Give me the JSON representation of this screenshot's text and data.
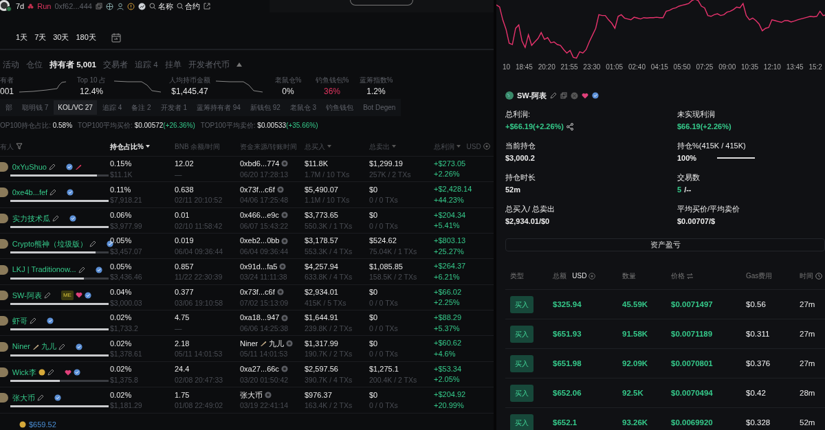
{
  "header": {
    "period": "7d",
    "run_label": "Run",
    "address": "0xf62...444",
    "search_links": [
      "名称",
      "合约"
    ]
  },
  "ranges": [
    {
      "label": "1天",
      "selected": false
    },
    {
      "label": "7天",
      "selected": false
    },
    {
      "label": "30天",
      "selected": false
    },
    {
      "label": "180天",
      "selected": false
    }
  ],
  "tabs": [
    {
      "label": "活动",
      "selected": false
    },
    {
      "label": "仓位",
      "selected": false
    },
    {
      "label": "持有者 5,001",
      "selected": true
    },
    {
      "label": "交易者",
      "selected": false
    },
    {
      "label": "追踪 4",
      "selected": false
    },
    {
      "label": "挂单",
      "selected": false
    },
    {
      "label": "开发者代币",
      "selected": false
    }
  ],
  "stats": [
    {
      "label": "有者",
      "value": "001",
      "alert": false,
      "kind": "rising"
    },
    {
      "label": "Top 10 占",
      "value": "12.4%",
      "alert": false,
      "kind": "falling"
    },
    {
      "label": "人均持币金额",
      "value": "$1,445.47",
      "alert": false,
      "kind": "falling"
    },
    {
      "label": "老鼠仓%",
      "value": "0%",
      "alert": false,
      "kind": "plain"
    },
    {
      "label": "钓鱼钱包%",
      "value": "36%",
      "alert": true,
      "kind": "plain"
    },
    {
      "label": "蓝筹指数%",
      "value": "1.2%",
      "alert": false,
      "kind": "plain"
    }
  ],
  "filters": [
    {
      "label": "部",
      "selected": false
    },
    {
      "label": "聪明钱 7",
      "selected": false
    },
    {
      "label": "KOL/VC 27",
      "selected": true
    },
    {
      "label": "追踪 4",
      "selected": false
    },
    {
      "label": "备注 2",
      "selected": false
    },
    {
      "label": "开发者 1",
      "selected": false
    },
    {
      "label": "蓝筹持有者 94",
      "selected": false
    },
    {
      "label": "新钱包 92",
      "selected": false
    },
    {
      "label": "老鼠仓 3",
      "selected": false
    },
    {
      "label": "钓鱼钱包",
      "selected": false
    },
    {
      "label": "Bot Degen",
      "selected": false
    }
  ],
  "summary": [
    {
      "label": "OP100持仓占比:",
      "value": "0.58%"
    },
    {
      "label": "TOP100平均买价:",
      "value": "$0.00572",
      "change": "(+26.36%)"
    },
    {
      "label": "TOP100平均卖价:",
      "value": "$0.00533",
      "change": "(+35.66%)"
    }
  ],
  "holders": {
    "columns": [
      {
        "label": "有人",
        "filter": true,
        "active": false
      },
      {
        "label": "持仓占比%",
        "sort": true,
        "active": true
      },
      {
        "label": "BNB 余额/时间",
        "active": false
      },
      {
        "label": "资金来源/转账时间",
        "active": false
      },
      {
        "label": "总买入",
        "sort": true,
        "active": false
      },
      {
        "label": "总卖出",
        "sort": true,
        "active": false
      },
      {
        "label": "总利润",
        "sort": true,
        "active": false,
        "unit": "USD"
      }
    ],
    "rows": [
      {
        "name": "0xYuShuo",
        "verified": true,
        "pen_mark": true,
        "level": 0.88,
        "pct": "0.15%",
        "value": "$11.1K",
        "bnb": "12.02",
        "bnb_time": "—",
        "source": "0xbd6...774",
        "source_time": "06/20 17:28:13",
        "buy": "$11.8K",
        "buy_sub": "1.7M / 10 TXs",
        "sell": "$1,299.19",
        "sell_sub": "257K / 2 TXs",
        "profit": "+$273.05",
        "profit_pct": "+2.26%"
      },
      {
        "name": "0xe4b...fef",
        "verified": true,
        "level": 1,
        "pct": "0.11%",
        "value": "$7,918.21",
        "bnb": "0.638",
        "bnb_time": "02/11 20:10:52",
        "source": "0x73f...c6f",
        "source_time": "04/06 17:25:48",
        "buy": "$5,490.07",
        "buy_sub": "1.1M / 10 TXs",
        "sell": "$0",
        "sell_sub": "0 / 0 TXs",
        "profit": "+$2,428.14",
        "profit_pct": "+44.23%"
      },
      {
        "name": "实力技术瓜",
        "verified": true,
        "level": 1,
        "pct": "0.06%",
        "value": "$3,977.99",
        "bnb": "0.01",
        "bnb_time": "02/10 11:58:42",
        "source": "0x466...e9c",
        "source_time": "06/07 15:43:22",
        "buy": "$3,773.65",
        "buy_sub": "550.3K / 1 TXs",
        "sell": "$0",
        "sell_sub": "0 / 0 TXs",
        "profit": "+$204.34",
        "profit_pct": "+5.41%"
      },
      {
        "name": "Crypto熊神（垃圾版）",
        "verified": true,
        "level": 0.87,
        "pct": "0.05%",
        "value": "$3,457.07",
        "bnb": "0.019",
        "bnb_time": "06/04 09:36:44",
        "source": "0xeb2...0bb",
        "source_time": "06/04 09:36:44",
        "buy": "$3,178.57",
        "buy_sub": "553.3K / 4 TXs",
        "sell": "$524.62",
        "sell_sub": "75.04K / 1 TXs",
        "profit": "+$803.13",
        "profit_pct": "+25.27%"
      },
      {
        "name": "LKJ | Traditionow...",
        "verified": true,
        "level": 0.75,
        "pct": "0.05%",
        "value": "$3,436.46",
        "bnb": "0.857",
        "bnb_time": "11/22 22:30:39",
        "source": "0x91d...fa5",
        "source_time": "03/24 11:11:38",
        "buy": "$4,257.94",
        "buy_sub": "633.8K / 4 TXs",
        "sell": "$1,085.85",
        "sell_sub": "158.5K / 2 TXs",
        "profit": "+$264.37",
        "profit_pct": "+6.21%"
      },
      {
        "name": "SW-阿表",
        "tag": "ME",
        "verified": true,
        "heart": true,
        "level": 1,
        "pct": "0.04%",
        "value": "$3,000.03",
        "bnb": "0.377",
        "bnb_time": "03/06 19:10:58",
        "source": "0x73f...c6f",
        "source_time": "07/02 15:13:09",
        "buy": "$2,934.01",
        "buy_sub": "415K / 5 TXs",
        "sell": "$0",
        "sell_sub": "0 / 0 TXs",
        "profit": "+$66.02",
        "profit_pct": "+2.25%"
      },
      {
        "name": "虾哥",
        "verified": true,
        "level": 1,
        "pct": "0.02%",
        "value": "$1,733.2",
        "bnb": "4.75",
        "bnb_time": "—",
        "source": "0xa18...947",
        "source_time": "06/06 14:25:38",
        "buy": "$1,644.91",
        "buy_sub": "239.8K / 2 TXs",
        "sell": "$0",
        "sell_sub": "0 / 0 TXs",
        "profit": "+$88.29",
        "profit_pct": "+5.37%"
      },
      {
        "name": "Niner",
        "feather_after_name": true,
        "name_after": "九儿",
        "verified": true,
        "level": 1,
        "pct": "0.02%",
        "value": "$1,378.61",
        "bnb": "2.18",
        "bnb_time": "05/11 14:01:53",
        "source": "Niner",
        "feather_after_source": true,
        "source_after": "九儿",
        "source_time": "05/11 14:01:53",
        "buy": "$1,317.99",
        "buy_sub": "190.7K / 2 TXs",
        "sell": "$0",
        "sell_sub": "0 / 0 TXs",
        "profit": "+$60.62",
        "profit_pct": "+4.6%"
      },
      {
        "name": "Wick李",
        "coin_after_name": true,
        "verified": true,
        "heart": true,
        "level": 0.5,
        "pct": "0.02%",
        "value": "$1,375.8",
        "bnb": "24.4",
        "bnb_time": "02/08 20:47:33",
        "source": "0xa27...66c",
        "source_time": "03/20 01:50:42",
        "buy": "$2,597.56",
        "buy_sub": "390.7K / 4 TXs",
        "sell": "$1,275.1",
        "sell_sub": "200.4K / 2 TXs",
        "profit": "+$53.34",
        "profit_pct": "+2.05%"
      },
      {
        "name": "张大币",
        "verified": true,
        "level": 1,
        "pct": "0.02%",
        "value": "$1,181.29",
        "bnb": "1.75",
        "bnb_time": "01/08 22:49:02",
        "source": "张大币",
        "source_time": "03/19 22:41:14",
        "buy": "$976.37",
        "buy_sub": "163.4K / 2 TXs",
        "sell": "$0",
        "sell_sub": "0 / 0 TXs",
        "profit": "+$204.92",
        "profit_pct": "+20.99%"
      }
    ],
    "footer_value": "$659.52"
  },
  "chart": {
    "x_labels": [
      "10",
      "18:45",
      "20:20",
      "21:55",
      "23:30",
      "01:05",
      "02:40",
      "04:15",
      "05:50",
      "07:25",
      "09:00",
      "10:35",
      "12:10",
      "13:45",
      "15:2"
    ]
  },
  "profile": {
    "name": "SW-阿表",
    "heart": true,
    "verified": true
  },
  "position": [
    {
      "label": "总利润:",
      "value": "+$66.19(+2.26%)",
      "positive": true,
      "share": true
    },
    {
      "label": "未实现利润",
      "value": "$66.19(+2.26%)",
      "positive": true
    },
    {
      "label": "当前持仓",
      "value": "$3,000.2",
      "positive": false
    },
    {
      "label": "持仓%(415K / 415K)",
      "value": "100%",
      "positive": false,
      "level": 1
    },
    {
      "label": "持仓时长",
      "value": "52m",
      "positive": false
    },
    {
      "label": "交易数",
      "value": "5",
      "positive": true,
      "rest": "/--"
    },
    {
      "label": "总买入/ 总卖出",
      "value": "$2,934.01/$0",
      "positive": false
    },
    {
      "label": "平均买价/平均卖价",
      "value": "$0.00707/$",
      "positive": false
    }
  ],
  "pnl_button": "资产盈亏",
  "trades": {
    "columns": [
      "类型",
      "总额",
      "数量",
      "价格",
      "Gas费用",
      "时间"
    ],
    "amount_unit": "USD",
    "rows": [
      {
        "kind": "buy",
        "type": "买入",
        "amount": "$325.94",
        "qty": "45.59K",
        "price": "$0.0071497",
        "gas": "$0.56",
        "time": "27m"
      },
      {
        "kind": "buy",
        "type": "买入",
        "amount": "$651.93",
        "qty": "91.58K",
        "price": "$0.0071189",
        "gas": "$0.311",
        "time": "27m"
      },
      {
        "kind": "buy",
        "type": "买入",
        "amount": "$651.98",
        "qty": "92.09K",
        "price": "$0.0070801",
        "gas": "$0.376",
        "time": "27m"
      },
      {
        "kind": "buy",
        "type": "买入",
        "amount": "$652.06",
        "qty": "92.5K",
        "price": "$0.0070494",
        "gas": "$0.42",
        "time": "28m"
      },
      {
        "kind": "buy",
        "type": "买入",
        "amount": "$652.1",
        "qty": "93.26K",
        "price": "$0.0069920",
        "gas": "$0.328",
        "time": "52m"
      }
    ]
  }
}
